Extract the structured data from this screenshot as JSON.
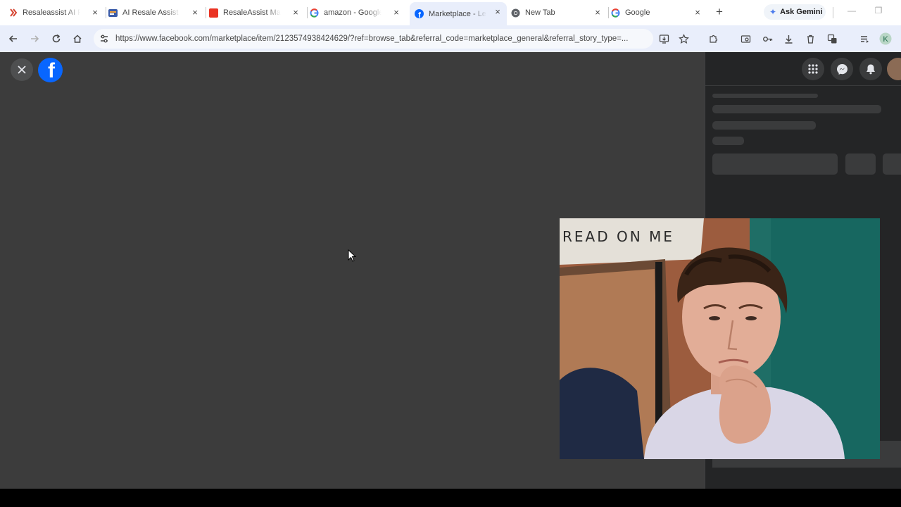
{
  "tabs": [
    {
      "title": "Resaleassist AI Pro",
      "icon": "resaleassist-icon",
      "close": "×"
    },
    {
      "title": "AI Resale Assist —",
      "icon": "ai-resale-icon",
      "close": "×"
    },
    {
      "title": "ResaleAssist Mark",
      "icon": "resaleassist-red-icon",
      "close": "×"
    },
    {
      "title": "amazon - Google",
      "icon": "google-icon",
      "close": "×"
    },
    {
      "title": "Marketplace - Lea",
      "icon": "facebook-icon",
      "close": "×",
      "active": true
    },
    {
      "title": "New Tab",
      "icon": "chrome-icon",
      "close": "×"
    },
    {
      "title": "Google",
      "icon": "google-icon",
      "close": "×"
    }
  ],
  "new_tab_label": "+",
  "gemini": {
    "label": "Ask Gemini",
    "icon": "gemini-star-icon"
  },
  "window_controls": {
    "minimize": "—",
    "restore": "❐"
  },
  "toolbar": {
    "url": "https://www.facebook.com/marketplace/item/2123574938424629/?ref=browse_tab&referral_code=marketplace_general&referral_story_type=..."
  },
  "page": {
    "close_icon": "×",
    "logo_letter": "f"
  },
  "colors": {
    "facebook_blue": "#0866ff",
    "page_bg": "#3c3c3c",
    "sidebar_bg": "#242526",
    "skeleton": "#3a3b3c"
  }
}
